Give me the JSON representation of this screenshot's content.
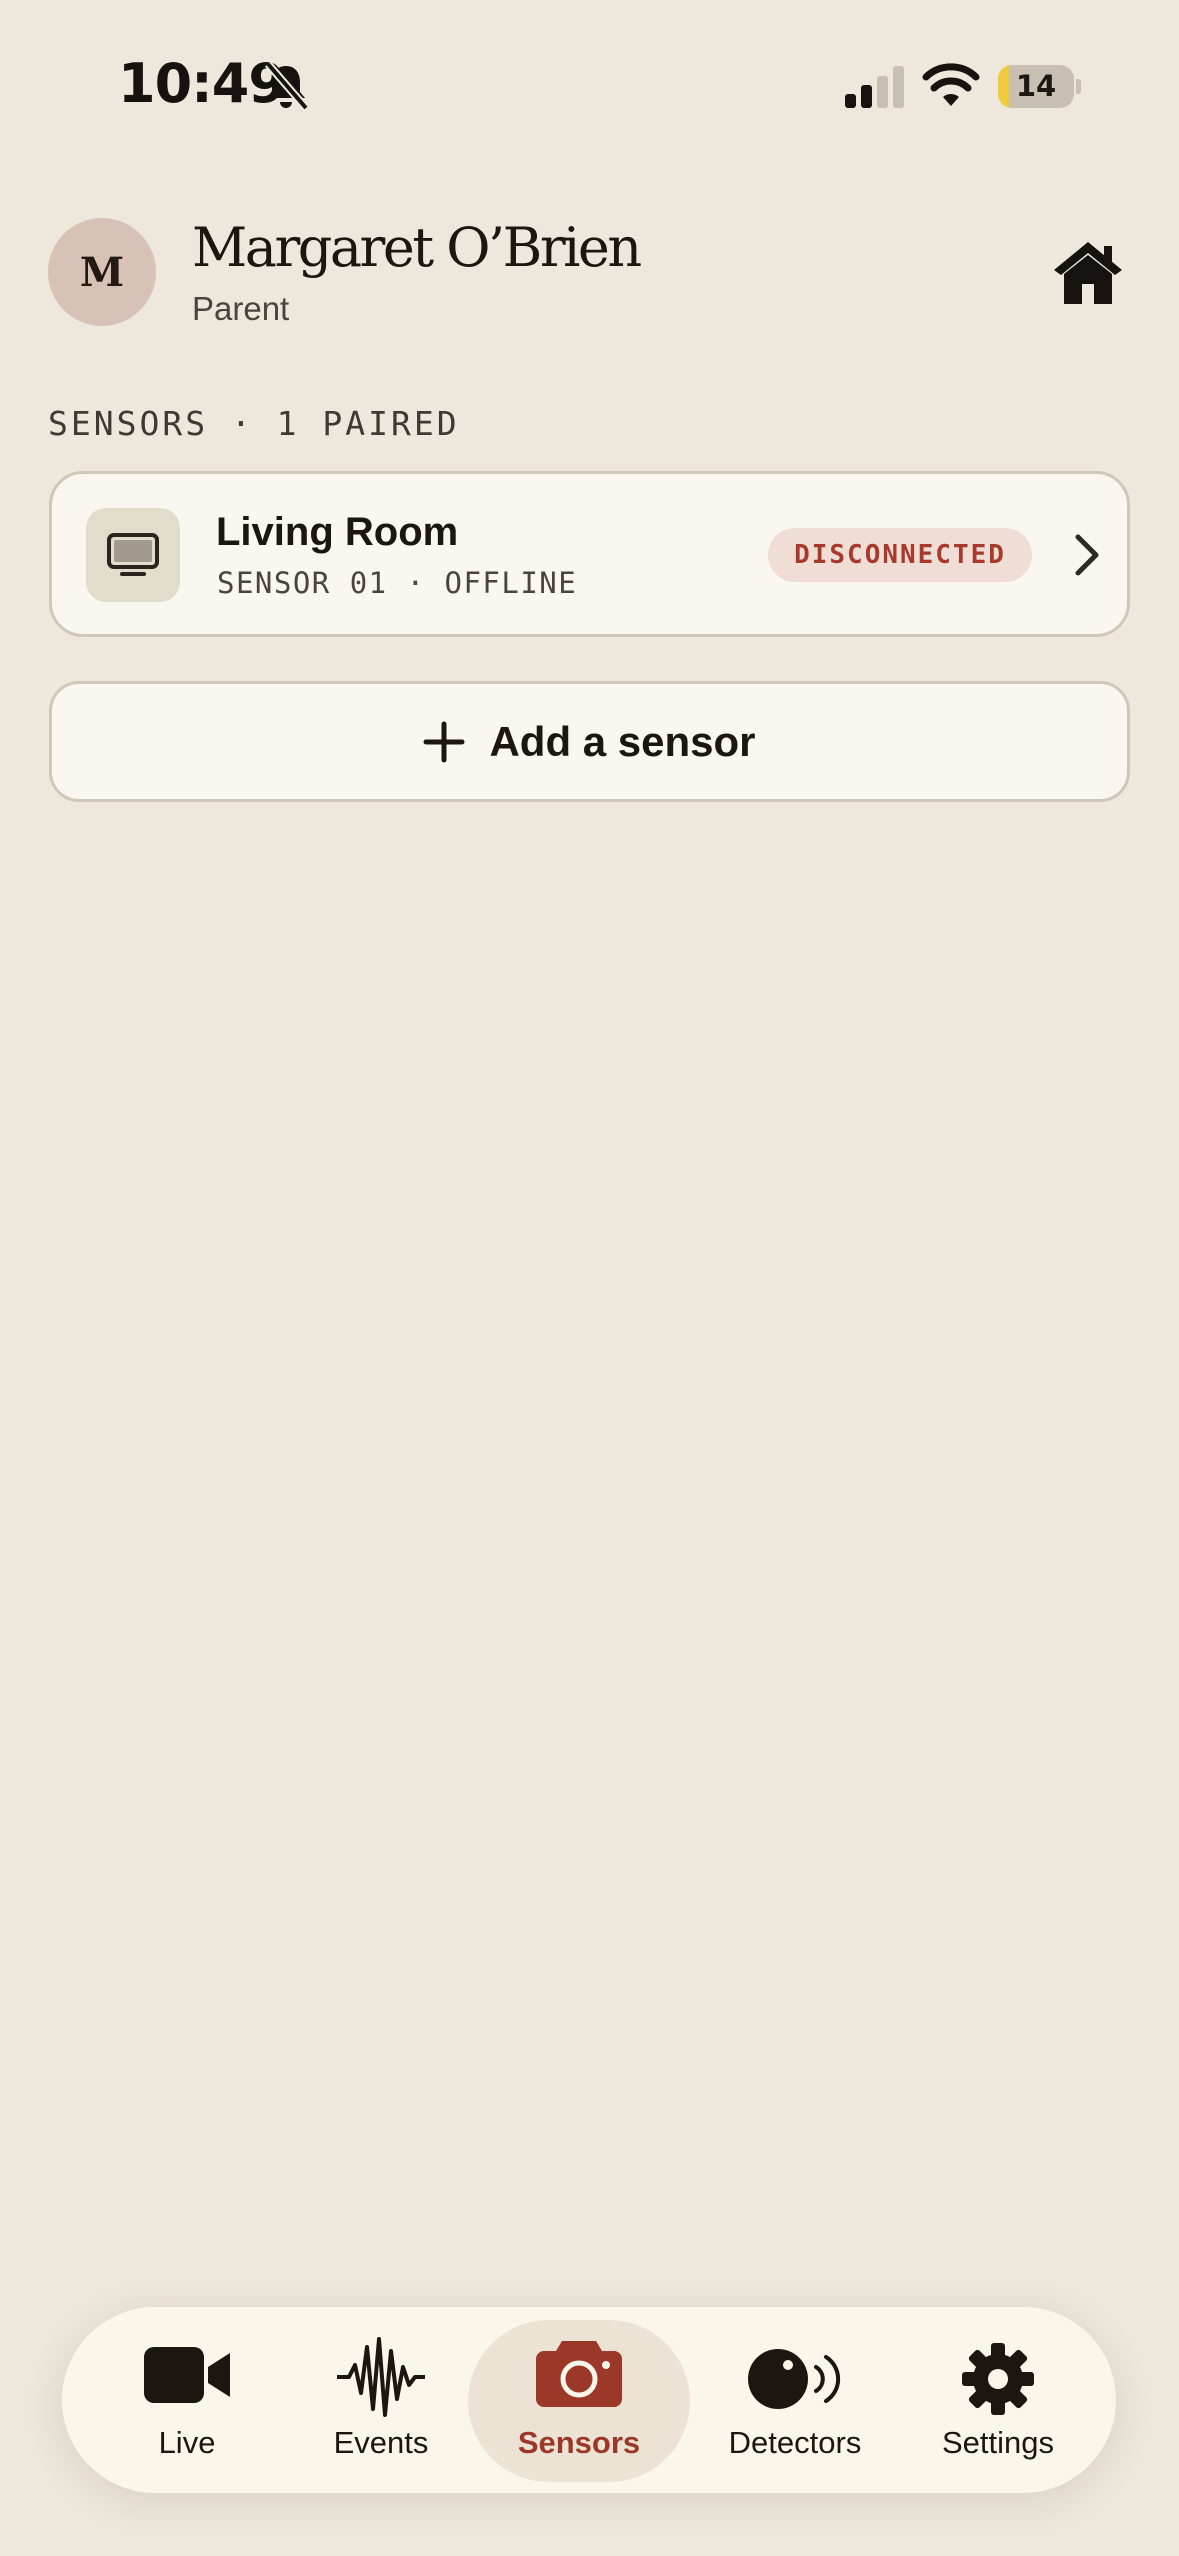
{
  "status_bar": {
    "time": "10:49",
    "battery_level": "14",
    "battery_fraction": 0.14,
    "icons": [
      "bell-slash-icon",
      "cellular-signal-icon",
      "wifi-icon",
      "battery-icon"
    ]
  },
  "header": {
    "avatar_initial": "M",
    "name": "Margaret O’Brien",
    "role": "Parent",
    "home_icon": "home-icon"
  },
  "sensors_section": {
    "title": "SENSORS · 1 PAIRED",
    "items": [
      {
        "icon": "monitor-icon",
        "name": "Living Room",
        "meta": "SENSOR 01 · OFFLINE",
        "status": "DISCONNECTED"
      }
    ],
    "add_button_label": "Add a sensor"
  },
  "tab_bar": {
    "active": "Sensors",
    "tabs": [
      {
        "label": "Live",
        "icon": "video-camera-icon"
      },
      {
        "label": "Events",
        "icon": "waveform-icon"
      },
      {
        "label": "Sensors",
        "icon": "camera-icon"
      },
      {
        "label": "Detectors",
        "icon": "detector-icon"
      },
      {
        "label": "Settings",
        "icon": "gear-icon"
      }
    ]
  },
  "colors": {
    "background": "#ede7dc",
    "card": "#faf7f0",
    "accent": "#9b3828",
    "badge_bg": "#f0ddd6",
    "avatar_bg": "#d8c2b6",
    "battery_fill": "#f2cb3a"
  }
}
